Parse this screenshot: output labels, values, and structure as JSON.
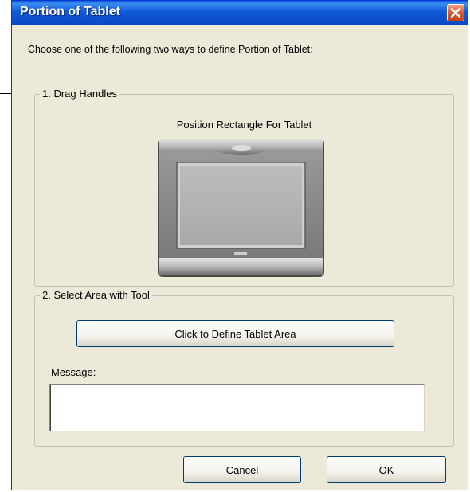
{
  "window": {
    "title": "Portion of Tablet",
    "close_icon": "close-icon"
  },
  "intro_text": "Choose one of the following two ways to define Portion of Tablet:",
  "group1": {
    "legend": "1. Drag Handles",
    "tablet_caption": "Position Rectangle For Tablet",
    "tablet_icon": "tablet-image"
  },
  "group2": {
    "legend": "2. Select Area with Tool",
    "define_button": "Click to Define Tablet Area",
    "message_label": "Message:",
    "message_value": ""
  },
  "buttons": {
    "cancel": "Cancel",
    "ok": "OK"
  },
  "colors": {
    "titlebar": "#0a49c5",
    "dialog_bg": "#ece9d8",
    "close_button": "#d9552a"
  }
}
